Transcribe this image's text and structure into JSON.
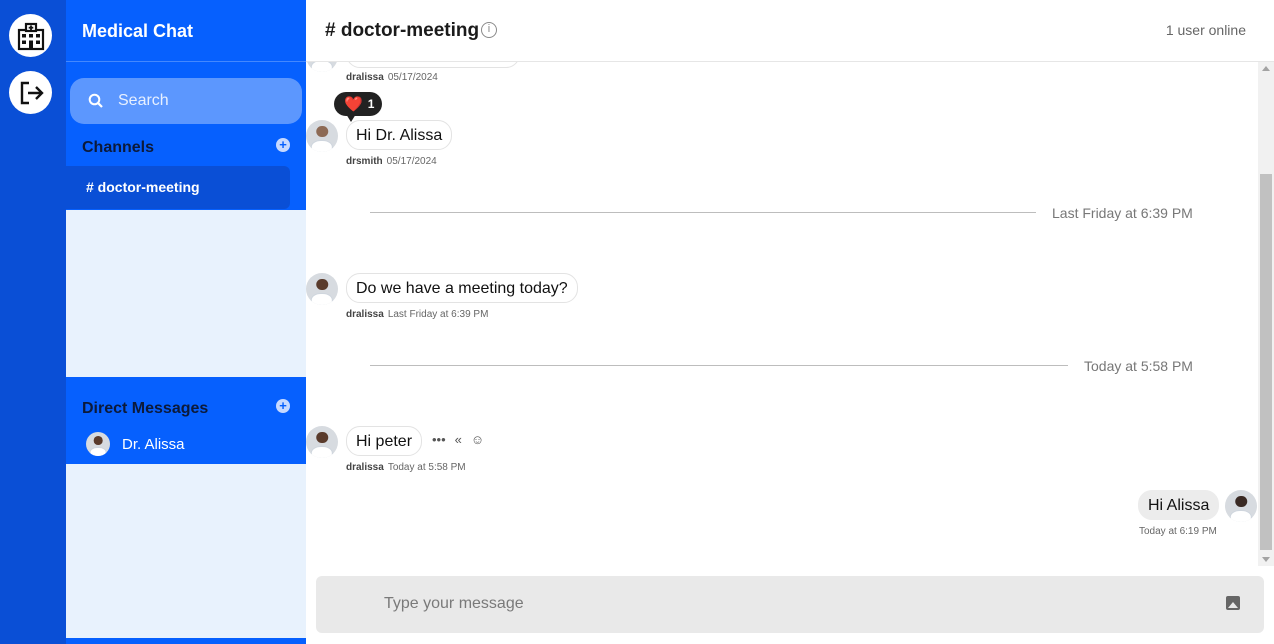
{
  "sidebar": {
    "title": "Medical Chat",
    "search_placeholder": "Search",
    "channels_label": "Channels",
    "channels": [
      {
        "label": "# doctor-meeting"
      }
    ],
    "direct_messages_label": "Direct Messages",
    "direct_messages": [
      {
        "label": "Dr. Alissa"
      }
    ]
  },
  "header": {
    "channel_title": "# doctor-meeting",
    "info_glyph": "i",
    "online_status": "1 user online"
  },
  "messages": {
    "top_cut": {
      "user": "dralissa",
      "time": "05/17/2024"
    },
    "msg1": {
      "text": "Hi Dr. Alissa",
      "user": "drsmith",
      "time": "05/17/2024",
      "reaction": {
        "emoji": "❤️",
        "count": "1"
      }
    },
    "divider1": "Last Friday at 6:39 PM",
    "msg2": {
      "text": "Do we have a meeting today?",
      "user": "dralissa",
      "time": "Last Friday at 6:39 PM"
    },
    "divider2": "Today at 5:58 PM",
    "msg3": {
      "text": "Hi peter",
      "user": "dralissa",
      "time": "Today at 5:58 PM",
      "actions": {
        "more": "•••",
        "reply": "«",
        "react": "☺"
      }
    },
    "msg4": {
      "text": "Hi Alissa",
      "time": "Today at 6:19 PM"
    }
  },
  "composer": {
    "placeholder": "Type your message"
  },
  "icons": {
    "rail_top": "hospital-icon",
    "rail_bottom": "logout-icon",
    "search": "search-icon",
    "add": "plus-circle-icon",
    "info": "info-icon",
    "image": "image-icon"
  },
  "colors": {
    "rail": "#0a4fd6",
    "sidebar_accent": "#0660fe",
    "sidebar_bg": "#e8f2fd",
    "active_channel": "#0a4fd6"
  }
}
